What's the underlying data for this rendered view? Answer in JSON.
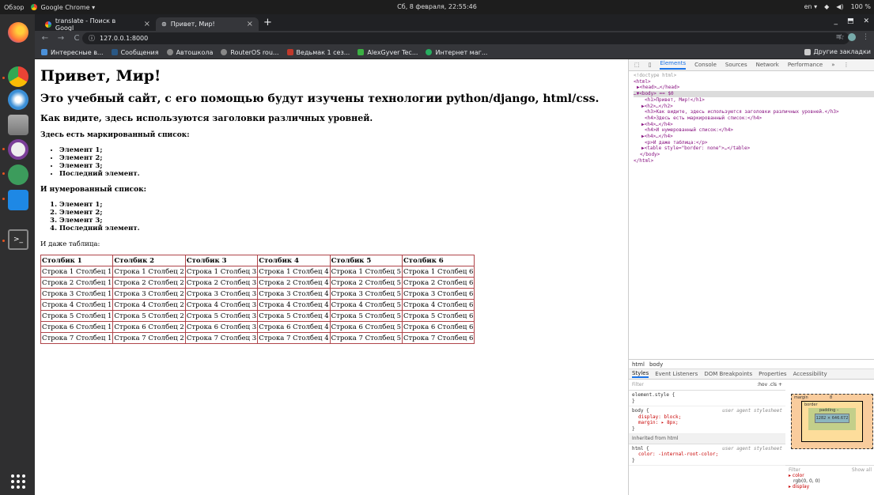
{
  "os": {
    "activities": "Обзор",
    "app_name": "Google Chrome ▾",
    "clock": "Сб, 8 февраля, 22:55:46",
    "lang": "en ▾",
    "battery": "100 %"
  },
  "chrome": {
    "tabs": [
      {
        "label": "translate - Поиск в Googl"
      },
      {
        "label": "Привет, Мир!"
      }
    ],
    "url": "127.0.0.1:8000",
    "bookmarks": [
      "Интересные в...",
      "Сообщения",
      "Автошкола",
      "RouterOS rou...",
      "Ведьмак 1 сез...",
      "AlexGyver Tec...",
      "Интернет маг..."
    ],
    "other_bookmarks": "Другие закладки"
  },
  "page": {
    "h1": "Привет, Мир!",
    "h2": "Это учебный сайт, с его помощью будут изучены технологии python/django, html/css.",
    "h3": "Как видите, здесь используются заголовки различных уровней.",
    "h4_bullets": "Здесь есть маркированный список:",
    "bullets": [
      "Элемент 1;",
      "Элемент 2;",
      "Элемент 3;",
      "Последний элемент."
    ],
    "h4_numbered": "И нумерованный список:",
    "numbered": [
      "Элемент 1;",
      "Элемент 2;",
      "Элемент 3;",
      "Последний элемент."
    ],
    "p_table": "И даже таблица:",
    "columns": [
      "Столбик 1",
      "Столбик 2",
      "Столбик 3",
      "Столбик 4",
      "Столбик 5",
      "Столбик 6"
    ],
    "rows": [
      [
        "Строка 1 Столбец 1",
        "Строка 1 Столбец 2",
        "Строка 1 Столбец 3",
        "Строка 1 Столбец 4",
        "Строка 1 Столбец 5",
        "Строка 1 Столбец 6"
      ],
      [
        "Строка 2 Столбец 1",
        "Строка 2 Столбец 2",
        "Строка 2 Столбец 3",
        "Строка 2 Столбец 4",
        "Строка 2 Столбец 5",
        "Строка 2 Столбец 6"
      ],
      [
        "Строка 3 Столбец 1",
        "Строка 3 Столбец 2",
        "Строка 3 Столбец 3",
        "Строка 3 Столбец 4",
        "Строка 3 Столбец 5",
        "Строка 3 Столбец 6"
      ],
      [
        "Строка 4 Столбец 1",
        "Строка 4 Столбец 2",
        "Строка 4 Столбец 3",
        "Строка 4 Столбец 4",
        "Строка 4 Столбец 5",
        "Строка 4 Столбец 6"
      ],
      [
        "Строка 5 Столбец 1",
        "Строка 5 Столбец 2",
        "Строка 5 Столбец 3",
        "Строка 5 Столбец 4",
        "Строка 5 Столбец 5",
        "Строка 5 Столбец 6"
      ],
      [
        "Строка 6 Столбец 1",
        "Строка 6 Столбец 2",
        "Строка 6 Столбец 3",
        "Строка 6 Столбец 4",
        "Строка 6 Столбец 5",
        "Строка 6 Столбец 6"
      ],
      [
        "Строка 7 Столбец 1",
        "Строка 7 Столбец 2",
        "Строка 7 Столбец 3",
        "Строка 7 Столбец 4",
        "Строка 7 Столбец 5",
        "Строка 7 Столбец 6"
      ]
    ]
  },
  "devtools": {
    "tabs": [
      "Elements",
      "Console",
      "Sources",
      "Network",
      "Performance",
      "»"
    ],
    "dom_lines": [
      "<!doctype html>",
      "<html>",
      "▶<head>…</head>",
      "…▼<body> == $0",
      "<h1>Привет, Мир!</h1>",
      "▶<h2>…</h2>",
      "<h3>Как видите, здесь используются заголовки различных уровней.</h3>",
      "<h4>Здесь есть маркированный список:</h4>",
      "▶<h4>…</h4>",
      "<h4>И нумерованный список:</h4>",
      "▶<h4>…</h4>",
      "<p>И даже таблица:</p>",
      "▶<table style=\"border: none\">…</table>",
      "</body>",
      "</html>"
    ],
    "crumbs": [
      "html",
      "body"
    ],
    "style_tabs": [
      "Styles",
      "Event Listeners",
      "DOM Breakpoints",
      "Properties",
      "Accessibility"
    ],
    "filter_placeholder": "Filter",
    "filter_tools": ":hov  .cls  +",
    "element_style": "element.style {",
    "body_rule": "body {",
    "body_src": "user agent stylesheet",
    "body_display": "display: block;",
    "body_margin": "margin: ▸ 8px;",
    "inherited": "Inherited from html",
    "html_rule": "html {",
    "html_src": "user agent stylesheet",
    "html_color": "color: -internal-root-color;",
    "box_margin": "margin",
    "box_border": "border",
    "box_padding": "padding –",
    "box_content": "1282 × 646.672",
    "box_margin_val": "8",
    "computed_filter": "Filter",
    "show_all": "Show all",
    "computed_color": "▸ color",
    "computed_color_val": "rgb(0, 0, 0)",
    "computed_display": "▸ display",
    "computed_display_val": "block"
  }
}
